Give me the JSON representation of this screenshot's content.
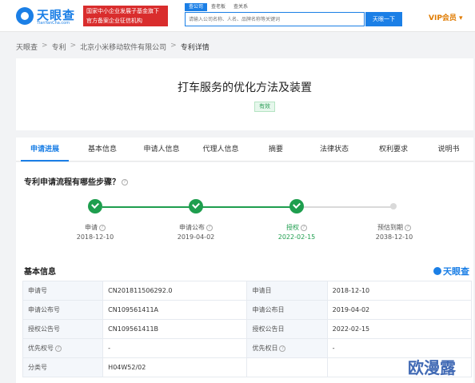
{
  "header": {
    "logo_text": "天眼查",
    "logo_sub": "TianYanCha.com",
    "badge_line1": "国家中小企业发展子基金旗下",
    "badge_line2": "官方备案企业征信机构",
    "search_tabs": [
      "查公司",
      "查老板",
      "查关系"
    ],
    "search_placeholder": "请输入公司名称、人名、品牌名称等关键词",
    "search_button": "天眼一下",
    "vip_label": "VIP会员 ▾"
  },
  "breadcrumb": [
    "天眼查",
    "专利",
    "北京小米移动软件有限公司",
    "专利详情"
  ],
  "patent": {
    "title": "打车服务的优化方法及装置",
    "status": "有效"
  },
  "tabs": [
    "申请进展",
    "基本信息",
    "申请人信息",
    "代理人信息",
    "摘要",
    "法律状态",
    "权利要求",
    "说明书"
  ],
  "process": {
    "heading": "专利申请流程有哪些步骤？",
    "steps": [
      {
        "label": "申请",
        "date": "2018-12-10",
        "done": true
      },
      {
        "label": "申请公布",
        "date": "2019-04-02",
        "done": true
      },
      {
        "label": "授权",
        "date": "2022-02-15",
        "done": true
      },
      {
        "label": "预估到期",
        "date": "2038-12-10",
        "done": false
      }
    ]
  },
  "basic_info": {
    "heading": "基本信息",
    "brand": "天眼查",
    "rows": [
      {
        "k1": "申请号",
        "v1": "CN201811506292.0",
        "k2": "申请日",
        "v2": "2018-12-10"
      },
      {
        "k1": "申请公布号",
        "v1": "CN109561411A",
        "k2": "申请公布日",
        "v2": "2019-04-02"
      },
      {
        "k1": "授权公告号",
        "v1": "CN109561411B",
        "k2": "授权公告日",
        "v2": "2022-02-15"
      },
      {
        "k1": "优先权号",
        "v1": "-",
        "k2": "优先权日",
        "v2": "-"
      },
      {
        "k1": "分类号",
        "v1": "H04W52/02",
        "k2": "",
        "v2": ""
      }
    ]
  },
  "watermark": "欧漫露",
  "colors": {
    "brand_blue": "#1b7fe6",
    "green": "#1e9e4e",
    "red_badge": "#d92d2d"
  }
}
